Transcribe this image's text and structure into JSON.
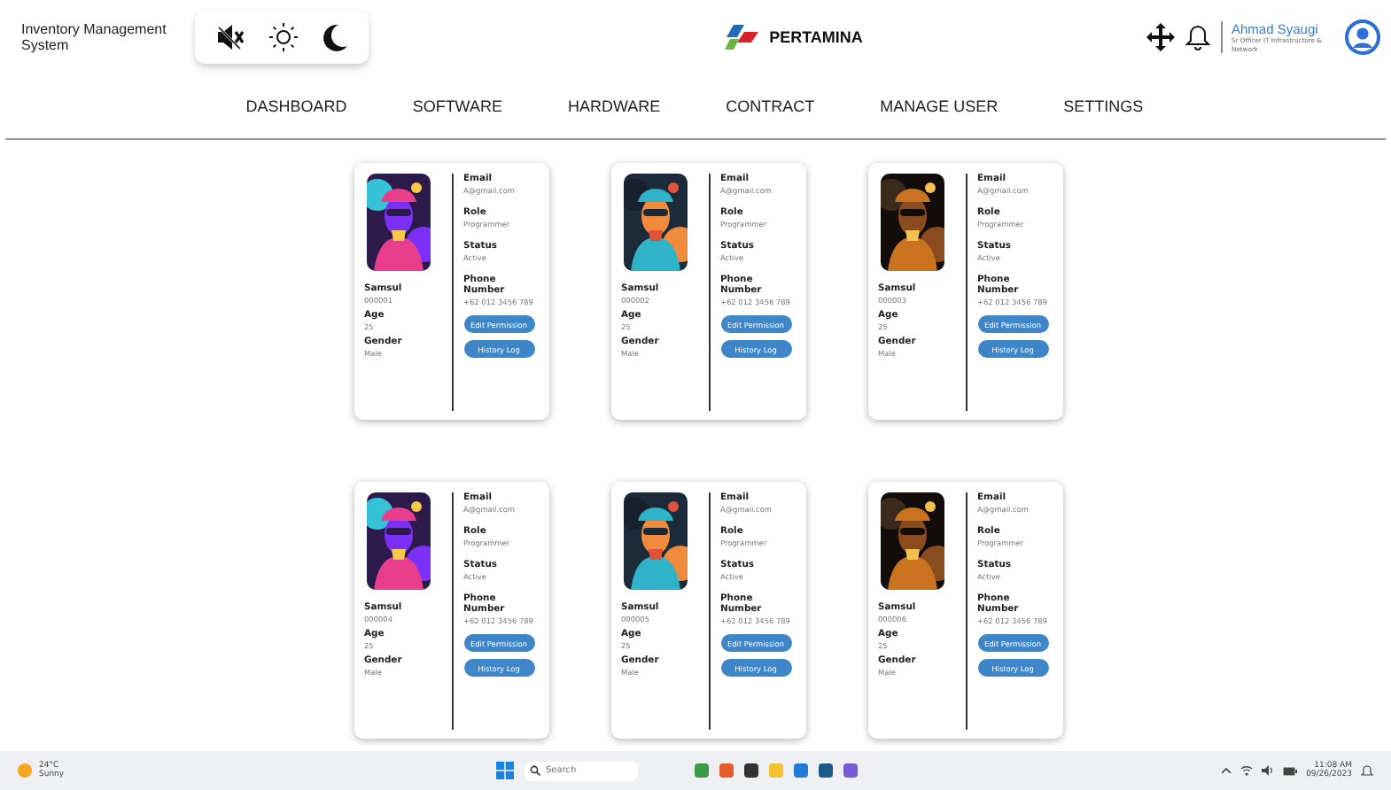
{
  "header": {
    "app_title": "Inventory Management System",
    "logo_text": "PERTAMINA",
    "user": {
      "name": "Ahmad Syaugi",
      "role": "Sr Officer IT Infrastructure & Network"
    }
  },
  "nav": [
    "DASHBOARD",
    "SOFTWARE",
    "HARDWARE",
    "CONTRACT",
    "MANAGE USER",
    "SETTINGS"
  ],
  "cards": [
    {
      "name": "Samsul",
      "id": "000001",
      "age_label": "Age",
      "age": "25",
      "gender_label": "Gender",
      "gender": "Male",
      "email_label": "Email",
      "email": "A@gmail.com",
      "role_label": "Role",
      "role": "Programmer",
      "status_label": "Status",
      "status": "Active",
      "phone_label": "Phone Number",
      "phone": "+62 012 3456 789",
      "buttons": [
        "Edit Permission",
        "History Log"
      ]
    },
    {
      "name": "Samsul",
      "id": "000002",
      "age_label": "Age",
      "age": "25",
      "gender_label": "Gender",
      "gender": "Male",
      "email_label": "Email",
      "email": "A@gmail.com",
      "role_label": "Role",
      "role": "Programmer",
      "status_label": "Status",
      "status": "Active",
      "phone_label": "Phone Number",
      "phone": "+62 012 3456 789",
      "buttons": [
        "Edit Permission",
        "History Log"
      ]
    },
    {
      "name": "Samsul",
      "id": "000003",
      "age_label": "Age",
      "age": "25",
      "gender_label": "Gender",
      "gender": "Male",
      "email_label": "Email",
      "email": "A@gmail.com",
      "role_label": "Role",
      "role": "Programmer",
      "status_label": "Status",
      "status": "Active",
      "phone_label": "Phone Number",
      "phone": "+62 012 3456 789",
      "buttons": [
        "Edit Permission",
        "History Log"
      ]
    },
    {
      "name": "Samsul",
      "id": "000004",
      "age_label": "Age",
      "age": "25",
      "gender_label": "Gender",
      "gender": "Male",
      "email_label": "Email",
      "email": "A@gmail.com",
      "role_label": "Role",
      "role": "Programmer",
      "status_label": "Status",
      "status": "Active",
      "phone_label": "Phone Number",
      "phone": "+62 012 3456 789",
      "buttons": [
        "Edit Permission",
        "History Log"
      ]
    },
    {
      "name": "Samsul",
      "id": "000005",
      "age_label": "Age",
      "age": "25",
      "gender_label": "Gender",
      "gender": "Male",
      "email_label": "Email",
      "email": "A@gmail.com",
      "role_label": "Role",
      "role": "Programmer",
      "status_label": "Status",
      "status": "Active",
      "phone_label": "Phone Number",
      "phone": "+62 012 3456 789",
      "buttons": [
        "Edit Permission",
        "History Log"
      ]
    },
    {
      "name": "Samsul",
      "id": "000006",
      "age_label": "Age",
      "age": "25",
      "gender_label": "Gender",
      "gender": "Male",
      "email_label": "Email",
      "email": "A@gmail.com",
      "role_label": "Role",
      "role": "Programmer",
      "status_label": "Status",
      "status": "Active",
      "phone_label": "Phone Number",
      "phone": "+62 012 3456 789",
      "buttons": [
        "Edit Permission",
        "History Log"
      ]
    }
  ],
  "taskbar": {
    "temperature": "24°C",
    "weather": "Sunny",
    "search_placeholder": "Search",
    "time": "11:08 AM",
    "date": "09/26/2023"
  }
}
